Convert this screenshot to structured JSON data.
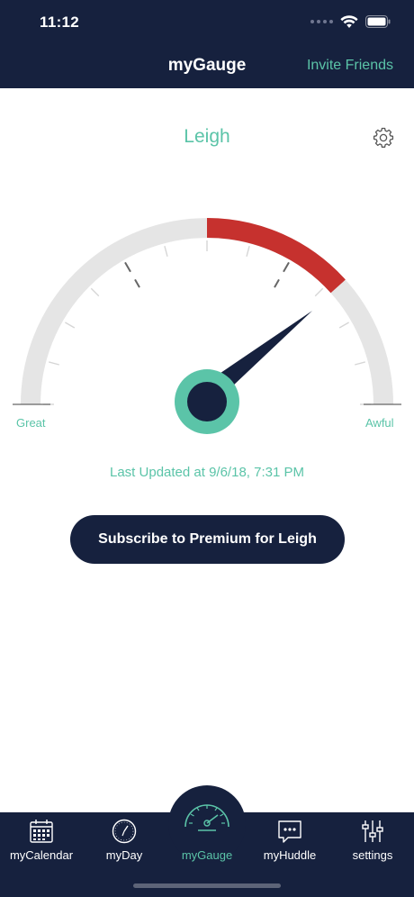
{
  "status_bar": {
    "time": "11:12"
  },
  "header": {
    "title": "myGauge",
    "invite_label": "Invite Friends"
  },
  "profile": {
    "name": "Leigh"
  },
  "gauge": {
    "left_label": "Great",
    "right_label": "Awful",
    "ticks": 13,
    "colors": {
      "track": "#e5e5e5",
      "active": "#c6312e",
      "needle": "#16213e",
      "hub_ring": "#5bc4a8"
    }
  },
  "last_updated": "Last Updated at 9/6/18, 7:31 PM",
  "subscribe_label": "Subscribe to Premium for Leigh",
  "tabs": [
    {
      "label": "myCalendar",
      "icon": "calendar-icon",
      "active": false
    },
    {
      "label": "myDay",
      "icon": "clock-icon",
      "active": false
    },
    {
      "label": "myGauge",
      "icon": "gauge-icon",
      "active": true
    },
    {
      "label": "myHuddle",
      "icon": "chat-bubble-icon",
      "active": false
    },
    {
      "label": "settings",
      "icon": "sliders-icon",
      "active": false
    }
  ],
  "colors": {
    "navy": "#16213e",
    "teal": "#5bc4a8",
    "red": "#c6312e"
  }
}
